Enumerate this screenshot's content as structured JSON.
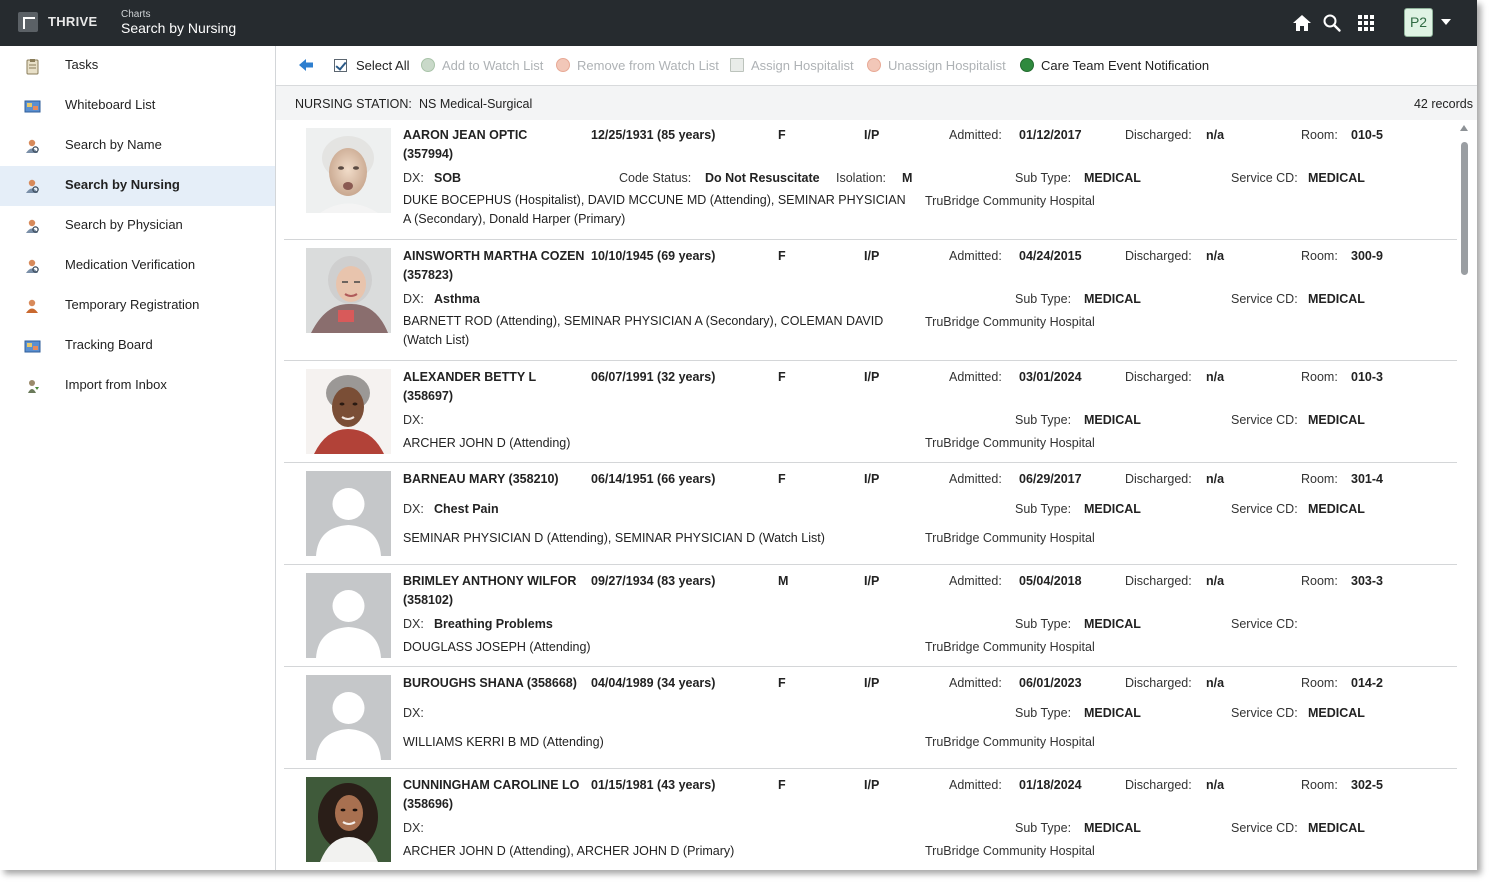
{
  "app": {
    "name": "THRIVE",
    "section": "Charts",
    "page_title": "Search by Nursing",
    "user_initials": "P2"
  },
  "sidebar": {
    "items": [
      {
        "label": "Tasks",
        "icon": "clipboard-icon"
      },
      {
        "label": "Whiteboard List",
        "icon": "whiteboard-icon"
      },
      {
        "label": "Search by Name",
        "icon": "person-search-icon"
      },
      {
        "label": "Search by Nursing",
        "icon": "person-search-icon",
        "active": true
      },
      {
        "label": "Search by Physician",
        "icon": "person-search-icon"
      },
      {
        "label": "Medication Verification",
        "icon": "person-search-icon"
      },
      {
        "label": "Temporary Registration",
        "icon": "person-add-icon"
      },
      {
        "label": "Tracking Board",
        "icon": "whiteboard-icon"
      },
      {
        "label": "Import from Inbox",
        "icon": "import-icon"
      }
    ]
  },
  "toolbar": {
    "select_all": "Select All",
    "add_watch": "Add to Watch List",
    "remove_watch": "Remove from Watch List",
    "assign_hosp": "Assign Hospitalist",
    "unassign_hosp": "Unassign Hospitalist",
    "care_team": "Care Team Event Notification"
  },
  "station": {
    "label": "NURSING STATION:",
    "value": "NS Medical-Surgical",
    "records": "42 records"
  },
  "labels": {
    "dx": "DX:",
    "code_status": "Code Status:",
    "isolation": "Isolation:",
    "admitted": "Admitted:",
    "discharged": "Discharged:",
    "room": "Room:",
    "sub_type": "Sub Type:",
    "service_cd": "Service CD:"
  },
  "patients": [
    {
      "name": "AARON JEAN OPTIC",
      "id": "(357994)",
      "dob": "12/25/1931 (85 years)",
      "sex": "F",
      "type": "I/P",
      "admitted": "01/12/2017",
      "discharged": "n/a",
      "room": "010-5",
      "dx": "SOB",
      "code_status": "Do Not Resuscitate",
      "isolation": "M",
      "sub_type": "MEDICAL",
      "service_cd": "MEDICAL",
      "providers": "DUKE BOCEPHUS (Hospitalist), DAVID MCCUNE MD (Attending), SEMINAR PHYSICIAN A (Secondary), Donald Harper (Primary)",
      "facility": "TruBridge Community Hospital",
      "photo": "elderly-woman"
    },
    {
      "name": "AINSWORTH MARTHA COZEN",
      "id": "(357823)",
      "dob": "10/10/1945 (69 years)",
      "sex": "F",
      "type": "I/P",
      "admitted": "04/24/2015",
      "discharged": "n/a",
      "room": "300-9",
      "dx": "Asthma",
      "sub_type": "MEDICAL",
      "service_cd": "MEDICAL",
      "providers": "BARNETT ROD (Attending), SEMINAR PHYSICIAN A (Secondary), COLEMAN DAVID (Watch List)",
      "facility": "TruBridge Community Hospital",
      "photo": "gray-hair-woman"
    },
    {
      "name": "ALEXANDER BETTY L",
      "id": "(358697)",
      "dob": "06/07/1991 (32 years)",
      "sex": "F",
      "type": "I/P",
      "admitted": "03/01/2024",
      "discharged": "n/a",
      "room": "010-3",
      "dx": "",
      "sub_type": "MEDICAL",
      "service_cd": "MEDICAL",
      "providers": "ARCHER JOHN D (Attending)",
      "facility": "TruBridge Community Hospital",
      "photo": "older-woman"
    },
    {
      "name": "BARNEAU MARY (358210)",
      "id": "",
      "dob": "06/14/1951 (66 years)",
      "sex": "F",
      "type": "I/P",
      "admitted": "06/29/2017",
      "discharged": "n/a",
      "room": "301-4",
      "dx": "Chest Pain",
      "sub_type": "MEDICAL",
      "service_cd": "MEDICAL",
      "providers": "SEMINAR PHYSICIAN D (Attending), SEMINAR PHYSICIAN D (Watch List)",
      "facility": "TruBridge Community Hospital",
      "photo": "placeholder"
    },
    {
      "name": "BRIMLEY ANTHONY WILFOR",
      "id": "(358102)",
      "dob": "09/27/1934 (83 years)",
      "sex": "M",
      "type": "I/P",
      "admitted": "05/04/2018",
      "discharged": "n/a",
      "room": "303-3",
      "dx": "Breathing Problems",
      "sub_type": "MEDICAL",
      "service_cd": "",
      "providers": "DOUGLASS JOSEPH (Attending)",
      "facility": "TruBridge Community Hospital",
      "photo": "placeholder"
    },
    {
      "name": "BUROUGHS SHANA (358668)",
      "id": "",
      "dob": "04/04/1989 (34 years)",
      "sex": "F",
      "type": "I/P",
      "admitted": "06/01/2023",
      "discharged": "n/a",
      "room": "014-2",
      "dx": "",
      "sub_type": "MEDICAL",
      "service_cd": "MEDICAL",
      "providers": "WILLIAMS KERRI B MD (Attending)",
      "facility": "TruBridge Community Hospital",
      "photo": "placeholder"
    },
    {
      "name": "CUNNINGHAM CAROLINE LO",
      "id": "(358696)",
      "dob": "01/15/1981 (43 years)",
      "sex": "F",
      "type": "I/P",
      "admitted": "01/18/2024",
      "discharged": "n/a",
      "room": "302-5",
      "dx": "",
      "sub_type": "MEDICAL",
      "service_cd": "MEDICAL",
      "providers": "ARCHER JOHN D (Attending), ARCHER JOHN D (Primary)",
      "facility": "TruBridge Community Hospital",
      "photo": "curly-hair-woman"
    }
  ]
}
